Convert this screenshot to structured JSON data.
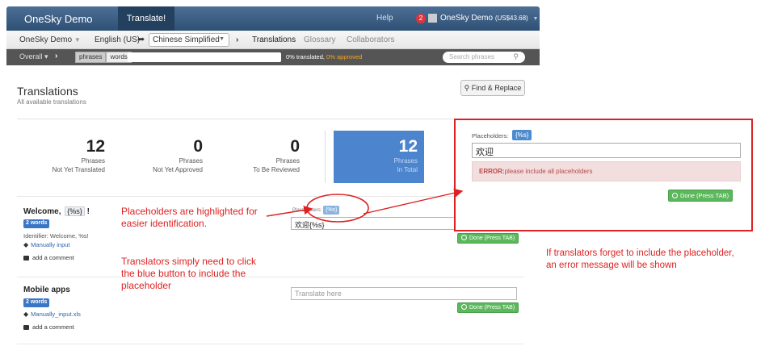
{
  "topbar": {
    "brand": "OneSky Demo",
    "tab": "Translate!",
    "help": "Help",
    "notifications": "2",
    "account_name": "OneSky Demo",
    "account_balance": "(US$43.68)"
  },
  "subnav": {
    "project": "OneSky Demo",
    "source_language": "English (US)",
    "target_language": "Chinese Simplified",
    "tabs": [
      "Translations",
      "Glossary",
      "Collaborators"
    ]
  },
  "filterbar": {
    "overall": "Overall",
    "toggle": [
      "phrases",
      "words"
    ],
    "translated_text": "0% translated,",
    "approved_text": "0% approved",
    "search_placeholder": "Search phrases"
  },
  "page": {
    "title": "Translations",
    "subtitle": "All available translations",
    "find_replace": "Find & Replace"
  },
  "stats": [
    {
      "value": "12",
      "line1": "Phrases",
      "line2": "Not Yet Translated"
    },
    {
      "value": "0",
      "line1": "Phrases",
      "line2": "Not Yet Approved"
    },
    {
      "value": "0",
      "line1": "Phrases",
      "line2": "To Be Reviewed"
    },
    {
      "value": "12",
      "line1": "Phrases",
      "line2": "In Total"
    }
  ],
  "phrases": [
    {
      "title": "Welcome,",
      "placeholder": "{%s}",
      "suffix": "!",
      "words": "2 words",
      "identifier": "Identifier: Welcome, %s!",
      "tag": "Manually input",
      "comment": "add a comment",
      "placeholder_label": "Placeholders:",
      "translation": "欢迎{%s}",
      "done": "Done (Press TAB)"
    },
    {
      "title": "Mobile apps",
      "words": "2 words",
      "tag": "Manually_input.xls",
      "comment": "add a comment",
      "input_placeholder": "Translate here",
      "done": "Done (Press TAB)"
    }
  ],
  "annotations": {
    "left_1": "Placeholders are highlighted for easier identification.",
    "left_2": "Translators simply need to click the blue button to include the placeholder",
    "right": "If translators forget to include the placeholder, an error message will be shown"
  },
  "zoom_panel": {
    "label": "Placeholders:",
    "placeholder_button": "{%s}",
    "input_value": "欢迎",
    "error_prefix": "ERROR:",
    "error_text": "please include all placeholders",
    "done": "Done (Press TAB)"
  },
  "colors": {
    "navbar": "#2f5075",
    "accent_blue": "#4d84ce",
    "done_green": "#5cb85c",
    "annotation_red": "#dd2222",
    "error_bg": "#f2dede"
  }
}
